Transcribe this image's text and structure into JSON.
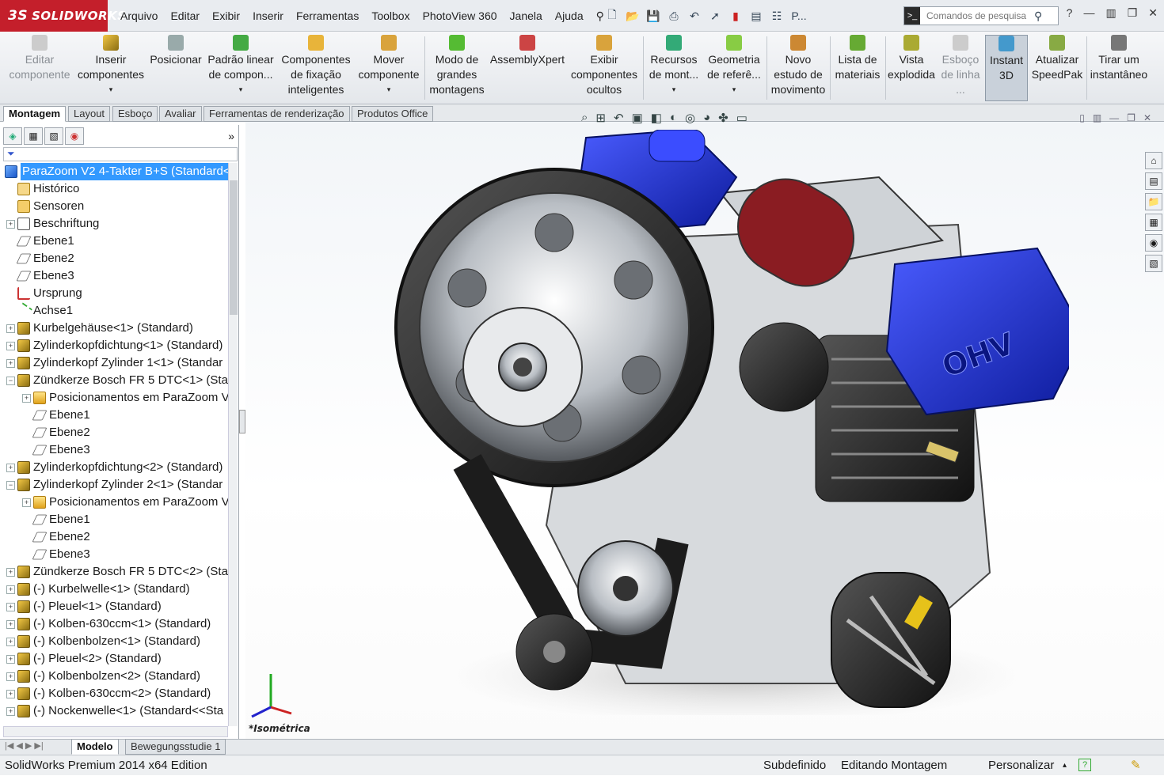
{
  "app": {
    "brand_ds": "3S",
    "brand": "SOLIDWORKS"
  },
  "menus": [
    "Arquivo",
    "Editar",
    "Exibir",
    "Inserir",
    "Ferramentas",
    "Toolbox",
    "PhotoView 360",
    "Janela",
    "Ajuda"
  ],
  "search": {
    "placeholder": "Comandos de pesquisa"
  },
  "quick_access": {
    "help": "?",
    "p_label": "P..."
  },
  "toolbar": [
    {
      "label": "Editar componente",
      "disabled": true
    },
    {
      "label": "Inserir componentes"
    },
    {
      "label": "Posicionar"
    },
    {
      "label": "Padrão linear de compon..."
    },
    {
      "label": "Componentes de fixação inteligentes"
    },
    {
      "label": "Mover componente"
    },
    {
      "label": "Modo de grandes montagens"
    },
    {
      "label": "AssemblyXpert"
    },
    {
      "label": "Exibir componentes ocultos"
    },
    {
      "label": "Recursos de mont..."
    },
    {
      "label": "Geometria de referê..."
    },
    {
      "label": "Novo estudo de movimento"
    },
    {
      "label": "Lista de materiais"
    },
    {
      "label": "Vista explodida"
    },
    {
      "label": "Esboço de linha ...",
      "disabled": true
    },
    {
      "label": "Instant 3D",
      "active": true
    },
    {
      "label": "Atualizar SpeedPak"
    },
    {
      "label": "Tirar um instantâneo"
    }
  ],
  "tabs": [
    "Montagem",
    "Layout",
    "Esboço",
    "Avaliar",
    "Ferramentas de renderização",
    "Produtos Office"
  ],
  "tree": [
    {
      "label": "ParaZoom V2 4-Takter B+S  (Standard<",
      "depth": 0,
      "icon": "root",
      "exp": ""
    },
    {
      "label": "Histórico",
      "depth": 1,
      "icon": "hist",
      "exp": ""
    },
    {
      "label": "Sensoren",
      "depth": 1,
      "icon": "sens",
      "exp": ""
    },
    {
      "label": "Beschriftung",
      "depth": 1,
      "icon": "anno",
      "exp": "+"
    },
    {
      "label": "Ebene1",
      "depth": 1,
      "icon": "plane",
      "exp": ""
    },
    {
      "label": "Ebene2",
      "depth": 1,
      "icon": "plane",
      "exp": ""
    },
    {
      "label": "Ebene3",
      "depth": 1,
      "icon": "plane",
      "exp": ""
    },
    {
      "label": "Ursprung",
      "depth": 1,
      "icon": "orig",
      "exp": ""
    },
    {
      "label": "Achse1",
      "depth": 1,
      "icon": "axis",
      "exp": ""
    },
    {
      "label": "Kurbelgehäuse<1> (Standard)",
      "depth": 1,
      "icon": "asm",
      "exp": "+"
    },
    {
      "label": "Zylinderkopfdichtung<1> (Standard)",
      "depth": 1,
      "icon": "asm",
      "exp": "+"
    },
    {
      "label": "Zylinderkopf Zylinder 1<1> (Standar",
      "depth": 1,
      "icon": "asm",
      "exp": "+"
    },
    {
      "label": "Zündkerze Bosch FR 5 DTC<1> (Stan",
      "depth": 1,
      "icon": "asm",
      "exp": "−"
    },
    {
      "label": "Posicionamentos em ParaZoom V",
      "depth": 2,
      "icon": "folder",
      "exp": "+"
    },
    {
      "label": "Ebene1",
      "depth": 2,
      "icon": "plane",
      "exp": ""
    },
    {
      "label": "Ebene2",
      "depth": 2,
      "icon": "plane",
      "exp": ""
    },
    {
      "label": "Ebene3",
      "depth": 2,
      "icon": "plane",
      "exp": ""
    },
    {
      "label": "Zylinderkopfdichtung<2> (Standard)",
      "depth": 1,
      "icon": "asm",
      "exp": "+"
    },
    {
      "label": "Zylinderkopf Zylinder 2<1> (Standar",
      "depth": 1,
      "icon": "asm",
      "exp": "−"
    },
    {
      "label": "Posicionamentos em ParaZoom V",
      "depth": 2,
      "icon": "folder",
      "exp": "+"
    },
    {
      "label": "Ebene1",
      "depth": 2,
      "icon": "plane",
      "exp": ""
    },
    {
      "label": "Ebene2",
      "depth": 2,
      "icon": "plane",
      "exp": ""
    },
    {
      "label": "Ebene3",
      "depth": 2,
      "icon": "plane",
      "exp": ""
    },
    {
      "label": "Zündkerze Bosch FR 5 DTC<2> (Stan",
      "depth": 1,
      "icon": "asm",
      "exp": "+"
    },
    {
      "label": "(-) Kurbelwelle<1> (Standard)",
      "depth": 1,
      "icon": "asm",
      "exp": "+"
    },
    {
      "label": "(-) Pleuel<1> (Standard)",
      "depth": 1,
      "icon": "asm",
      "exp": "+"
    },
    {
      "label": "(-) Kolben-630ccm<1> (Standard)",
      "depth": 1,
      "icon": "asm",
      "exp": "+"
    },
    {
      "label": "(-) Kolbenbolzen<1> (Standard)",
      "depth": 1,
      "icon": "asm",
      "exp": "+"
    },
    {
      "label": "(-) Pleuel<2> (Standard)",
      "depth": 1,
      "icon": "asm",
      "exp": "+"
    },
    {
      "label": "(-) Kolbenbolzen<2> (Standard)",
      "depth": 1,
      "icon": "asm",
      "exp": "+"
    },
    {
      "label": "(-) Kolben-630ccm<2> (Standard)",
      "depth": 1,
      "icon": "asm",
      "exp": "+"
    },
    {
      "label": "(-) Nockenwelle<1> (Standard<<Sta",
      "depth": 1,
      "icon": "asm",
      "exp": "+"
    }
  ],
  "viewport": {
    "view_label": "*Isométrica",
    "engine_text": "OHV"
  },
  "bottom_tabs": [
    "Modelo",
    "Bewegungsstudie 1"
  ],
  "status": {
    "edition": "SolidWorks Premium 2014 x64 Edition",
    "state": "Subdefinido",
    "mode": "Editando Montagem",
    "customize": "Personalizar"
  },
  "colors": {
    "accent_red": "#c41f2b",
    "selection_blue": "#3399ff",
    "engine_blue": "#1a2fd6"
  }
}
